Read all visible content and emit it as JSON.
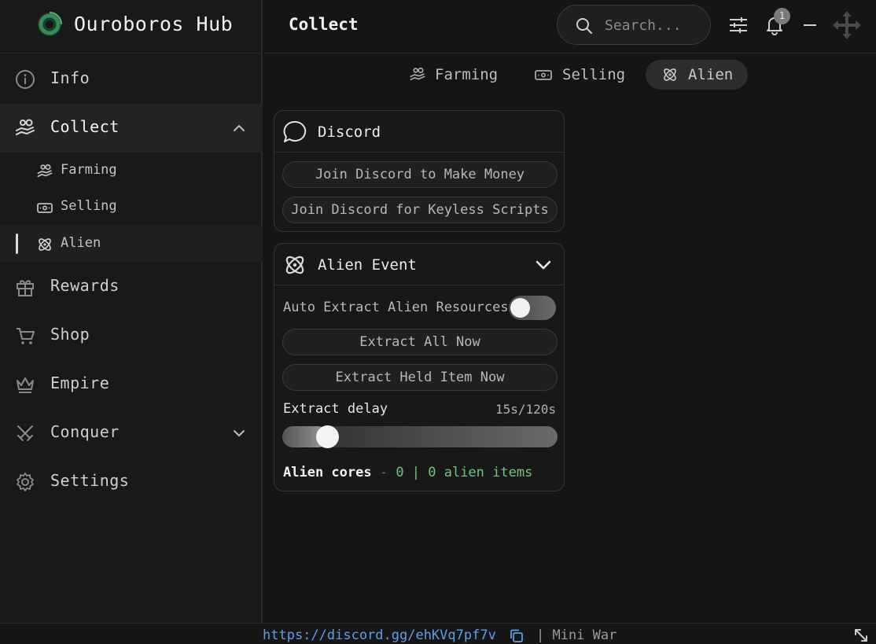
{
  "app": {
    "title": "Ouroboros Hub"
  },
  "colors": {
    "accent_green": "#6fc47f",
    "link_blue": "#5aa0e6",
    "logo_green": "#2f8f56"
  },
  "sidebar": {
    "items": [
      {
        "label": "Info",
        "icon": "info-icon"
      },
      {
        "label": "Collect",
        "icon": "hand-coins-icon",
        "expanded": true
      },
      {
        "label": "Rewards",
        "icon": "gift-icon"
      },
      {
        "label": "Shop",
        "icon": "cart-icon"
      },
      {
        "label": "Empire",
        "icon": "crown-icon"
      },
      {
        "label": "Conquer",
        "icon": "swords-icon",
        "expanded": false
      },
      {
        "label": "Settings",
        "icon": "gear-icon"
      }
    ],
    "sub_items": [
      {
        "label": "Farming",
        "icon": "hand-coins-icon"
      },
      {
        "label": "Selling",
        "icon": "banknote-icon"
      },
      {
        "label": "Alien",
        "icon": "atom-icon",
        "active": true
      }
    ]
  },
  "header": {
    "page_title": "Collect",
    "search_placeholder": "Search...",
    "notification_count": "1"
  },
  "tabs": [
    {
      "label": "Farming",
      "icon": "hand-coins-icon"
    },
    {
      "label": "Selling",
      "icon": "banknote-icon"
    },
    {
      "label": "Alien",
      "icon": "atom-icon",
      "active": true
    }
  ],
  "discord_card": {
    "title": "Discord",
    "buttons": [
      "Join Discord to Make Money",
      "Join Discord for Keyless Scripts"
    ]
  },
  "alien_card": {
    "title": "Alien Event",
    "toggle_label": "Auto Extract Alien Resources",
    "toggle_on": false,
    "buttons": [
      "Extract All Now",
      "Extract Held Item Now"
    ],
    "slider_label": "Extract delay",
    "slider_value_text": "15s/120s",
    "slider_value": 15,
    "slider_max": 120,
    "status_key": "Alien cores",
    "status_dash": " - ",
    "status_value": "0 | 0 alien items"
  },
  "footer": {
    "link": "https://discord.gg/ehKVq7pf7v",
    "rest": "| Mini War"
  }
}
